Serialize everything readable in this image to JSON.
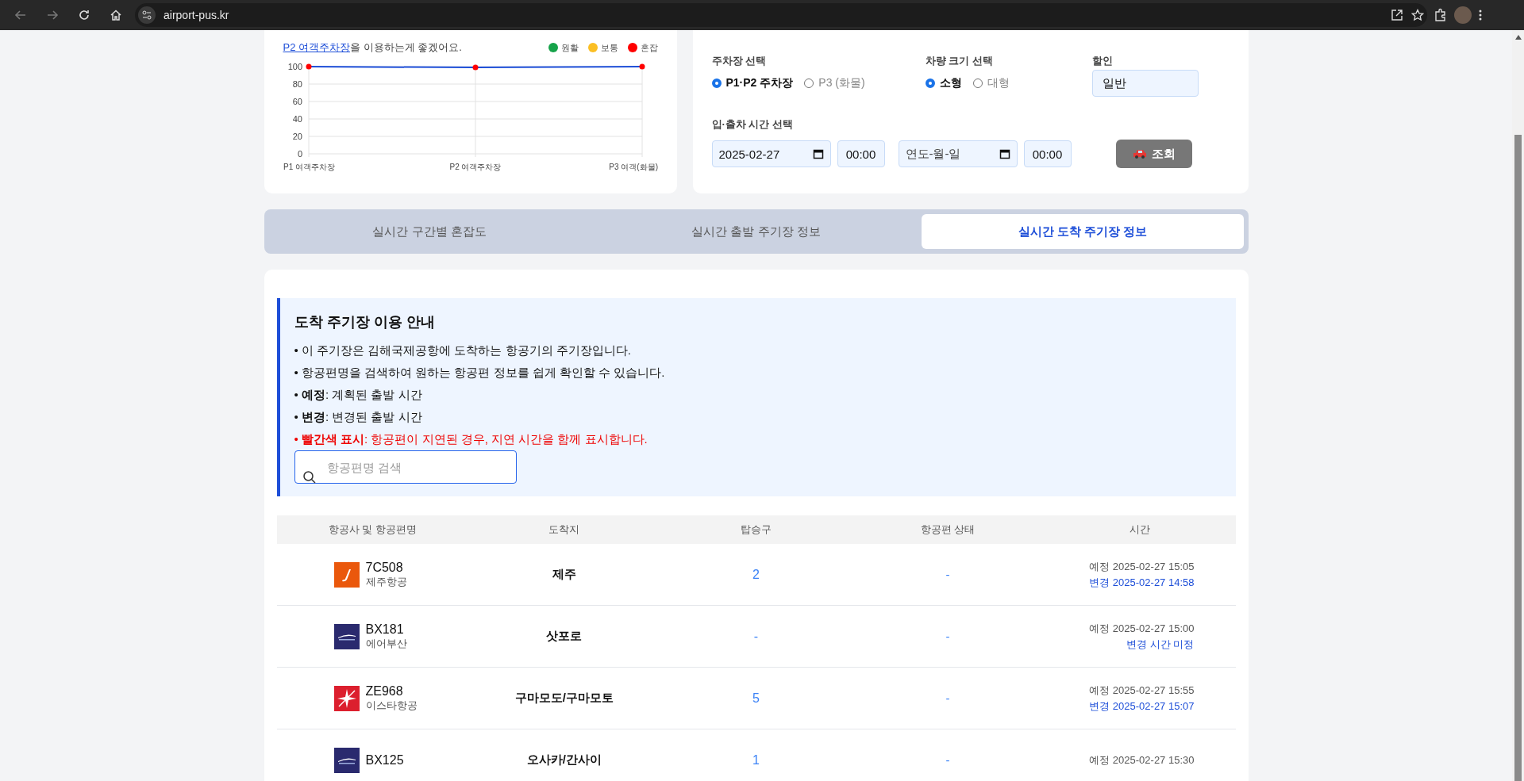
{
  "browser": {
    "url": "airport-pus.kr"
  },
  "congestion": {
    "recommendation_link": "P2 여객주차장",
    "recommendation_text": "을 이용하는게 좋겠어요.",
    "legend": [
      {
        "label": "원활",
        "color": "#16a34a"
      },
      {
        "label": "보통",
        "color": "#fbbf24"
      },
      {
        "label": "혼잡",
        "color": "#ff0000"
      }
    ],
    "chart_data": {
      "type": "line",
      "grid": true,
      "categories": [
        "P1 여객주차장",
        "P2 여객주차장",
        "P3 여객(화물)"
      ],
      "ylim": [
        0,
        100
      ],
      "yticks": [
        0,
        20,
        40,
        60,
        80,
        100
      ],
      "series": [
        {
          "color": "#1d4ed8",
          "marker": true,
          "values": [
            100,
            99,
            100
          ]
        }
      ]
    }
  },
  "fee_form": {
    "lot_label": "주차장 선택",
    "lot_options": [
      {
        "label": "P1·P2 주차장",
        "selected": true
      },
      {
        "label": "P3 (화물)",
        "selected": false
      }
    ],
    "size_label": "차량 크기 선택",
    "size_options": [
      {
        "label": "소형",
        "selected": true
      },
      {
        "label": "대형",
        "selected": false
      }
    ],
    "discount_label": "할인",
    "discount_value": "일반",
    "time_label": "입·출차 시간 선택",
    "entry_date": "2025-02-27",
    "entry_time": "00:00",
    "exit_date_placeholder": "연도-월-일",
    "exit_time": "00:00",
    "submit": "조회"
  },
  "tabs": [
    {
      "label": "실시간 구간별 혼잡도",
      "selected": false
    },
    {
      "label": "실시간 출발 주기장 정보",
      "selected": false
    },
    {
      "label": "실시간 도착 주기장 정보",
      "selected": true
    }
  ],
  "guide": {
    "title": "도착 주기장 이용 안내",
    "items": [
      {
        "kind": "normal",
        "text": "• 이 주기장은 김해국제공항에 도착하는 항공기의 주기장입니다."
      },
      {
        "kind": "normal",
        "text": "• 항공편명을 검색하여 원하는 항공편 정보를 쉽게 확인할 수 있습니다."
      },
      {
        "kind": "normal",
        "text": "• **예정**: 계획된 출발 시간"
      },
      {
        "kind": "normal",
        "text": "• **변경**: 변경된 출발 시간"
      },
      {
        "kind": "warning",
        "text": "• **빨간색 표시**: 항공편이 지연된 경우, 지연 시간을 함께 표시합니다."
      }
    ],
    "search_placeholder": "항공편명 검색"
  },
  "table": {
    "columns": [
      "항공사 및 항공편명",
      "도착지",
      "탑승구",
      "항공편 상태",
      "시간"
    ],
    "rows": [
      {
        "kind": "orange",
        "flight": "7C508",
        "airline": "제주항공",
        "destination": "제주",
        "gate": "2",
        "status": "-",
        "scheduled": "예정 2025-02-27 15:05",
        "changed": "변경 2025-02-27 14:58"
      },
      {
        "kind": "navy",
        "flight": "BX181",
        "airline": "에어부산",
        "destination": "삿포로",
        "gate": "-",
        "status": "-",
        "scheduled": "예정 2025-02-27 15:00",
        "changed": "변경 시간 미정"
      },
      {
        "kind": "red",
        "flight": "ZE968",
        "airline": "이스타항공",
        "destination": "구마모도/구마모토",
        "gate": "5",
        "status": "-",
        "scheduled": "예정 2025-02-27 15:55",
        "changed": "변경 2025-02-27 15:07"
      },
      {
        "kind": "navy",
        "flight": "BX125",
        "destination": "오사카/간사이",
        "gate": "1",
        "status": "-",
        "scheduled": "예정 2025-02-27 15:30"
      }
    ]
  }
}
